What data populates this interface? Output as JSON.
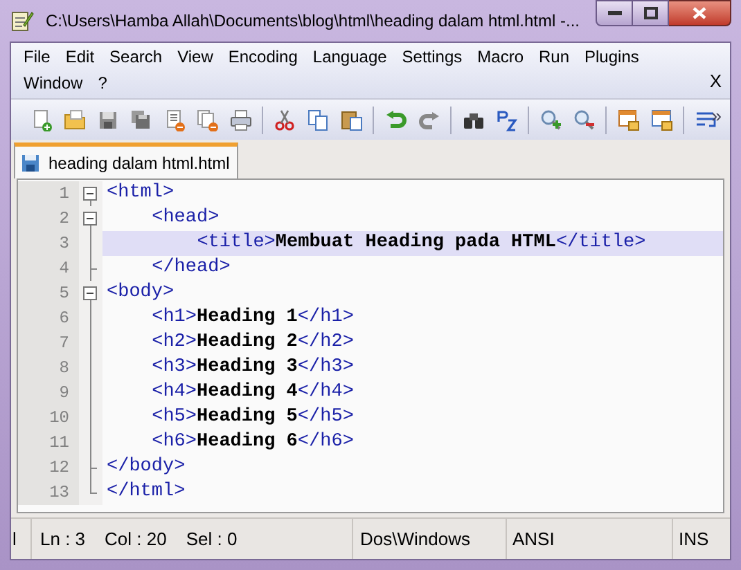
{
  "window": {
    "title": "C:\\Users\\Hamba Allah\\Documents\\blog\\html\\heading dalam html.html -..."
  },
  "menu": [
    "File",
    "Edit",
    "Search",
    "View",
    "Encoding",
    "Language",
    "Settings",
    "Macro",
    "Run",
    "Plugins",
    "Window",
    "?"
  ],
  "menu_close": "X",
  "toolbar_more": "»",
  "tabs": [
    {
      "label": "heading dalam html.html",
      "selected": true
    }
  ],
  "lines": [
    {
      "number": "1",
      "kind": "fold-start",
      "code": "<html>",
      "current": false,
      "children": [
        {
          "number": "2",
          "kind": "fold-start",
          "code": "<head>",
          "current": false,
          "children": [
            {
              "number": "3",
              "kind": "plain",
              "code": "<title>**Membuat Heading pada HTML**</title>",
              "current": true
            }
          ]
        },
        {
          "number": "4",
          "kind": "fold-end",
          "code": "</head>",
          "current": false
        }
      ]
    },
    {
      "number": "5",
      "kind": "fold-start",
      "code": "<body>",
      "current": false,
      "children": [
        {
          "number": "6",
          "kind": "plain",
          "code": "<h1>**Heading 1**</h1>",
          "current": false
        },
        {
          "number": "7",
          "kind": "plain",
          "code": "<h2>**Heading 2**</h2>",
          "current": false
        },
        {
          "number": "8",
          "kind": "plain",
          "code": "<h3>**Heading 3**</h3>",
          "current": false
        },
        {
          "number": "9",
          "kind": "plain",
          "code": "<h4>**Heading 4**</h4>",
          "current": false
        },
        {
          "number": "10",
          "kind": "plain",
          "code": "<h5>**Heading 5**</h5>",
          "current": false
        },
        {
          "number": "11",
          "kind": "plain",
          "code": "<h6>**Heading 6**</h6>",
          "current": false
        }
      ]
    },
    {
      "number": "12",
      "kind": "fold-end",
      "code": "</body>",
      "current": false
    },
    {
      "number": "13",
      "kind": "fold-last",
      "code": "</html>",
      "current": false
    }
  ],
  "status_bar": {
    "cut_label": "l",
    "position": [
      "Ln : 3",
      "Col : 20",
      "Sel : 0"
    ],
    "eol": "Dos\\Windows",
    "encoding": "ANSI",
    "mode": "INS"
  }
}
